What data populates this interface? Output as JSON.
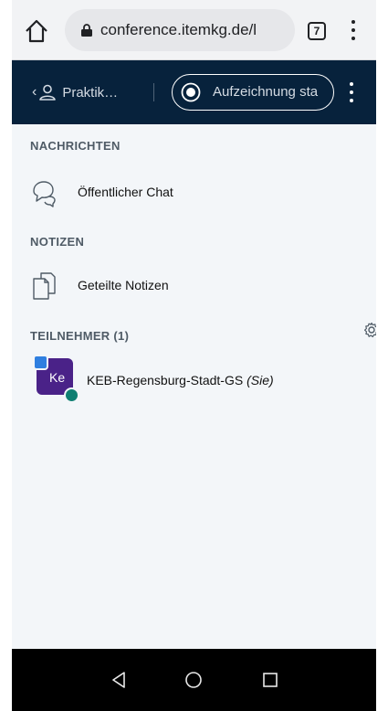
{
  "browser": {
    "url": "conference.itemkg.de/l",
    "tab_count": "7",
    "icons": {
      "home": "home-icon",
      "lock": "lock-icon",
      "menu": "more-vert-icon"
    }
  },
  "header": {
    "user_label": "Praktik…",
    "record_label": "Aufzeichnung sta",
    "icons": {
      "back": "chevron-left-icon",
      "user": "user-icon",
      "record": "record-icon",
      "menu": "more-vert-icon"
    }
  },
  "sections": {
    "messages": {
      "title": "NACHRICHTEN",
      "item_label": "Öffentlicher Chat",
      "icon": "chat-icon"
    },
    "notes": {
      "title": "NOTIZEN",
      "item_label": "Geteilte Notizen",
      "icon": "notes-icon"
    },
    "participants": {
      "title": "TEILNEHMER (1)",
      "settings_icon": "gear-icon",
      "items": [
        {
          "avatar_initials": "Ke",
          "name": "KEB-Regensburg-Stadt-GS",
          "you_label": "(Sie)"
        }
      ]
    }
  },
  "colors": {
    "app_header": "#07223c",
    "panel_bg": "#f3f6f9",
    "avatar": "#4a2288",
    "mic_badge": "#0f7f72",
    "presenter_badge": "#2f7fe0"
  },
  "nav": {
    "icons": [
      "back-triangle-icon",
      "home-circle-icon",
      "recents-square-icon"
    ]
  }
}
